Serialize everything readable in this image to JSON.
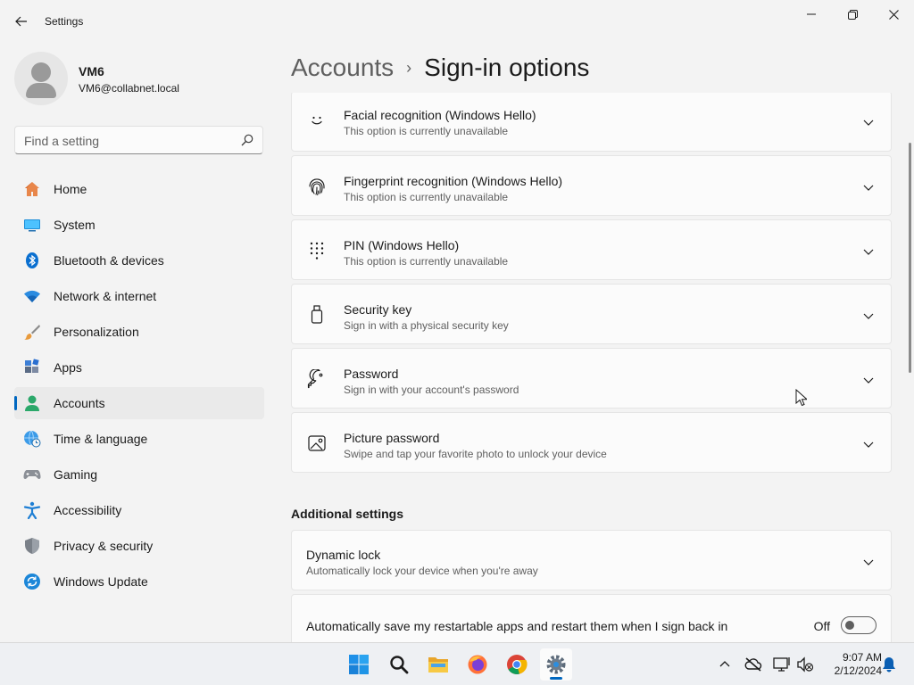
{
  "window": {
    "title": "Settings",
    "controls": [
      "minimize",
      "maximize",
      "close"
    ]
  },
  "user": {
    "name": "VM6",
    "email": "VM6@collabnet.local"
  },
  "search": {
    "placeholder": "Find a setting"
  },
  "sidebar": {
    "items": [
      {
        "label": "Home",
        "icon": "home-icon",
        "active": false
      },
      {
        "label": "System",
        "icon": "system-icon",
        "active": false
      },
      {
        "label": "Bluetooth & devices",
        "icon": "bluetooth-icon",
        "active": false
      },
      {
        "label": "Network & internet",
        "icon": "wifi-icon",
        "active": false
      },
      {
        "label": "Personalization",
        "icon": "brush-icon",
        "active": false
      },
      {
        "label": "Apps",
        "icon": "apps-icon",
        "active": false
      },
      {
        "label": "Accounts",
        "icon": "accounts-icon",
        "active": true
      },
      {
        "label": "Time & language",
        "icon": "globe-clock-icon",
        "active": false
      },
      {
        "label": "Gaming",
        "icon": "controller-icon",
        "active": false
      },
      {
        "label": "Accessibility",
        "icon": "accessibility-icon",
        "active": false
      },
      {
        "label": "Privacy & security",
        "icon": "shield-icon",
        "active": false
      },
      {
        "label": "Windows Update",
        "icon": "update-icon",
        "active": false
      }
    ]
  },
  "header": {
    "parent": "Accounts",
    "separator": "›",
    "current": "Sign-in options"
  },
  "cards": [
    {
      "title": "Facial recognition (Windows Hello)",
      "subtitle": "This option is currently unavailable",
      "icon": "face-icon"
    },
    {
      "title": "Fingerprint recognition (Windows Hello)",
      "subtitle": "This option is currently unavailable",
      "icon": "fingerprint-icon"
    },
    {
      "title": "PIN (Windows Hello)",
      "subtitle": "This option is currently unavailable",
      "icon": "keypad-icon"
    },
    {
      "title": "Security key",
      "subtitle": "Sign in with a physical security key",
      "icon": "usb-key-icon"
    },
    {
      "title": "Password",
      "subtitle": "Sign in with your account's password",
      "icon": "key-icon"
    },
    {
      "title": "Picture password",
      "subtitle": "Swipe and tap your favorite photo to unlock your device",
      "icon": "picture-icon"
    }
  ],
  "additional": {
    "heading": "Additional settings",
    "dynamic_lock": {
      "title": "Dynamic lock",
      "subtitle": "Automatically lock your device when you're away"
    },
    "restart_apps": {
      "title": "Automatically save my restartable apps and restart them when I sign back in",
      "state": "Off",
      "on": false
    }
  },
  "taskbar": {
    "apps": [
      "windows-start-icon",
      "search-icon",
      "file-explorer-icon",
      "firefox-icon",
      "chrome-icon",
      "settings-icon"
    ],
    "tray": [
      "chevron-up-icon",
      "cloud-off-icon",
      "network-display-icon",
      "volume-muted-icon",
      "notification-bell-icon"
    ],
    "time": "9:07 AM",
    "date": "2/12/2024"
  },
  "colors": {
    "accent": "#0067c0",
    "background": "#f3f3f3",
    "card": "#fbfbfb"
  }
}
